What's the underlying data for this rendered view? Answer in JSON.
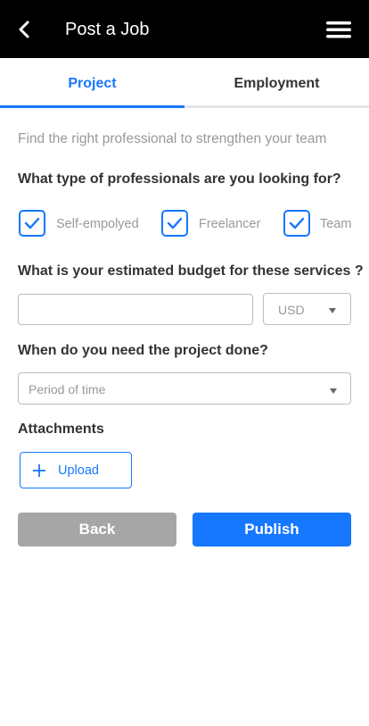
{
  "header": {
    "title": "Post a Job",
    "back_icon": "chevron-left-icon",
    "menu_icon": "hamburger-menu-icon"
  },
  "tabs": [
    {
      "label": "Project",
      "active": true
    },
    {
      "label": "Employment",
      "active": false
    }
  ],
  "form": {
    "subtitle": "Find the right professional to strengthen your team",
    "professional_type": {
      "label": "What type of professionals are you looking for?",
      "options": [
        {
          "label": "Self-empolyed",
          "checked": true
        },
        {
          "label": "Freelancer",
          "checked": true
        },
        {
          "label": "Team",
          "checked": true
        }
      ]
    },
    "budget": {
      "label": "What is your estimated budget for these services ?",
      "value": "",
      "placeholder": "",
      "currency": "USD"
    },
    "timeline": {
      "label": "When do you need the project done?",
      "placeholder": "Period of time"
    },
    "attachments": {
      "label": "Attachments",
      "upload_label": "Upload"
    },
    "actions": {
      "back_label": "Back",
      "publish_label": "Publish"
    }
  },
  "colors": {
    "accent": "#1677ff",
    "header_bg": "#000000",
    "disabled_button": "#a6a6a6"
  }
}
